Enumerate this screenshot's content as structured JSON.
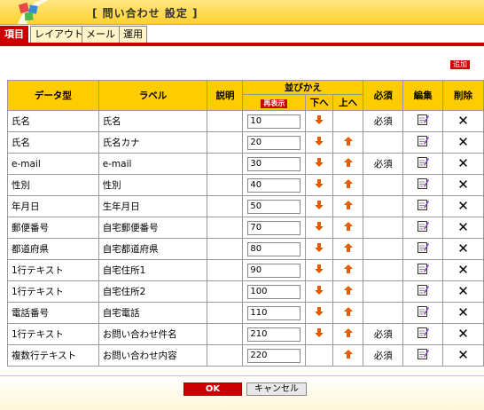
{
  "header": {
    "title": "[ 問い合わせ 設定 ]"
  },
  "tabs": [
    {
      "label": "項目",
      "active": true
    },
    {
      "label": "レイアウト",
      "active": false
    },
    {
      "label": "メール",
      "active": false
    },
    {
      "label": "運用",
      "active": false
    }
  ],
  "add_label": "追加",
  "columns": {
    "datatype": "データ型",
    "label": "ラベル",
    "description": "説明",
    "sort": "並びかえ",
    "redisplay": "再表示",
    "down": "下へ",
    "up": "上へ",
    "required": "必須",
    "edit": "編集",
    "delete": "削除"
  },
  "rows": [
    {
      "type": "氏名",
      "label": "氏名",
      "order": "10",
      "down": true,
      "up": false,
      "required": "必須"
    },
    {
      "type": "氏名",
      "label": "氏名カナ",
      "order": "20",
      "down": true,
      "up": true,
      "required": ""
    },
    {
      "type": "e-mail",
      "label": "e-mail",
      "order": "30",
      "down": true,
      "up": true,
      "required": "必須"
    },
    {
      "type": "性別",
      "label": "性別",
      "order": "40",
      "down": true,
      "up": true,
      "required": ""
    },
    {
      "type": "年月日",
      "label": "生年月日",
      "order": "50",
      "down": true,
      "up": true,
      "required": ""
    },
    {
      "type": "郵便番号",
      "label": "自宅郵便番号",
      "order": "70",
      "down": true,
      "up": true,
      "required": ""
    },
    {
      "type": "都道府県",
      "label": "自宅都道府県",
      "order": "80",
      "down": true,
      "up": true,
      "required": ""
    },
    {
      "type": "1行テキスト",
      "label": "自宅住所1",
      "order": "90",
      "down": true,
      "up": true,
      "required": ""
    },
    {
      "type": "1行テキスト",
      "label": "自宅住所2",
      "order": "100",
      "down": true,
      "up": true,
      "required": ""
    },
    {
      "type": "電話番号",
      "label": "自宅電話",
      "order": "110",
      "down": true,
      "up": true,
      "required": ""
    },
    {
      "type": "1行テキスト",
      "label": "お問い合わせ件名",
      "order": "210",
      "down": true,
      "up": true,
      "required": "必須"
    },
    {
      "type": "複数行テキスト",
      "label": "お問い合わせ内容",
      "order": "220",
      "down": false,
      "up": true,
      "required": "必須"
    }
  ],
  "footer": {
    "ok_label": "OK",
    "cancel_label": "キャンセル"
  },
  "colors": {
    "accent": "#cc0000",
    "header": "#ffcc00",
    "arrow": "#e85a00"
  },
  "icons": {
    "down": "arrow-down-icon",
    "up": "arrow-up-icon",
    "edit": "edit-icon",
    "delete": "close-icon"
  }
}
